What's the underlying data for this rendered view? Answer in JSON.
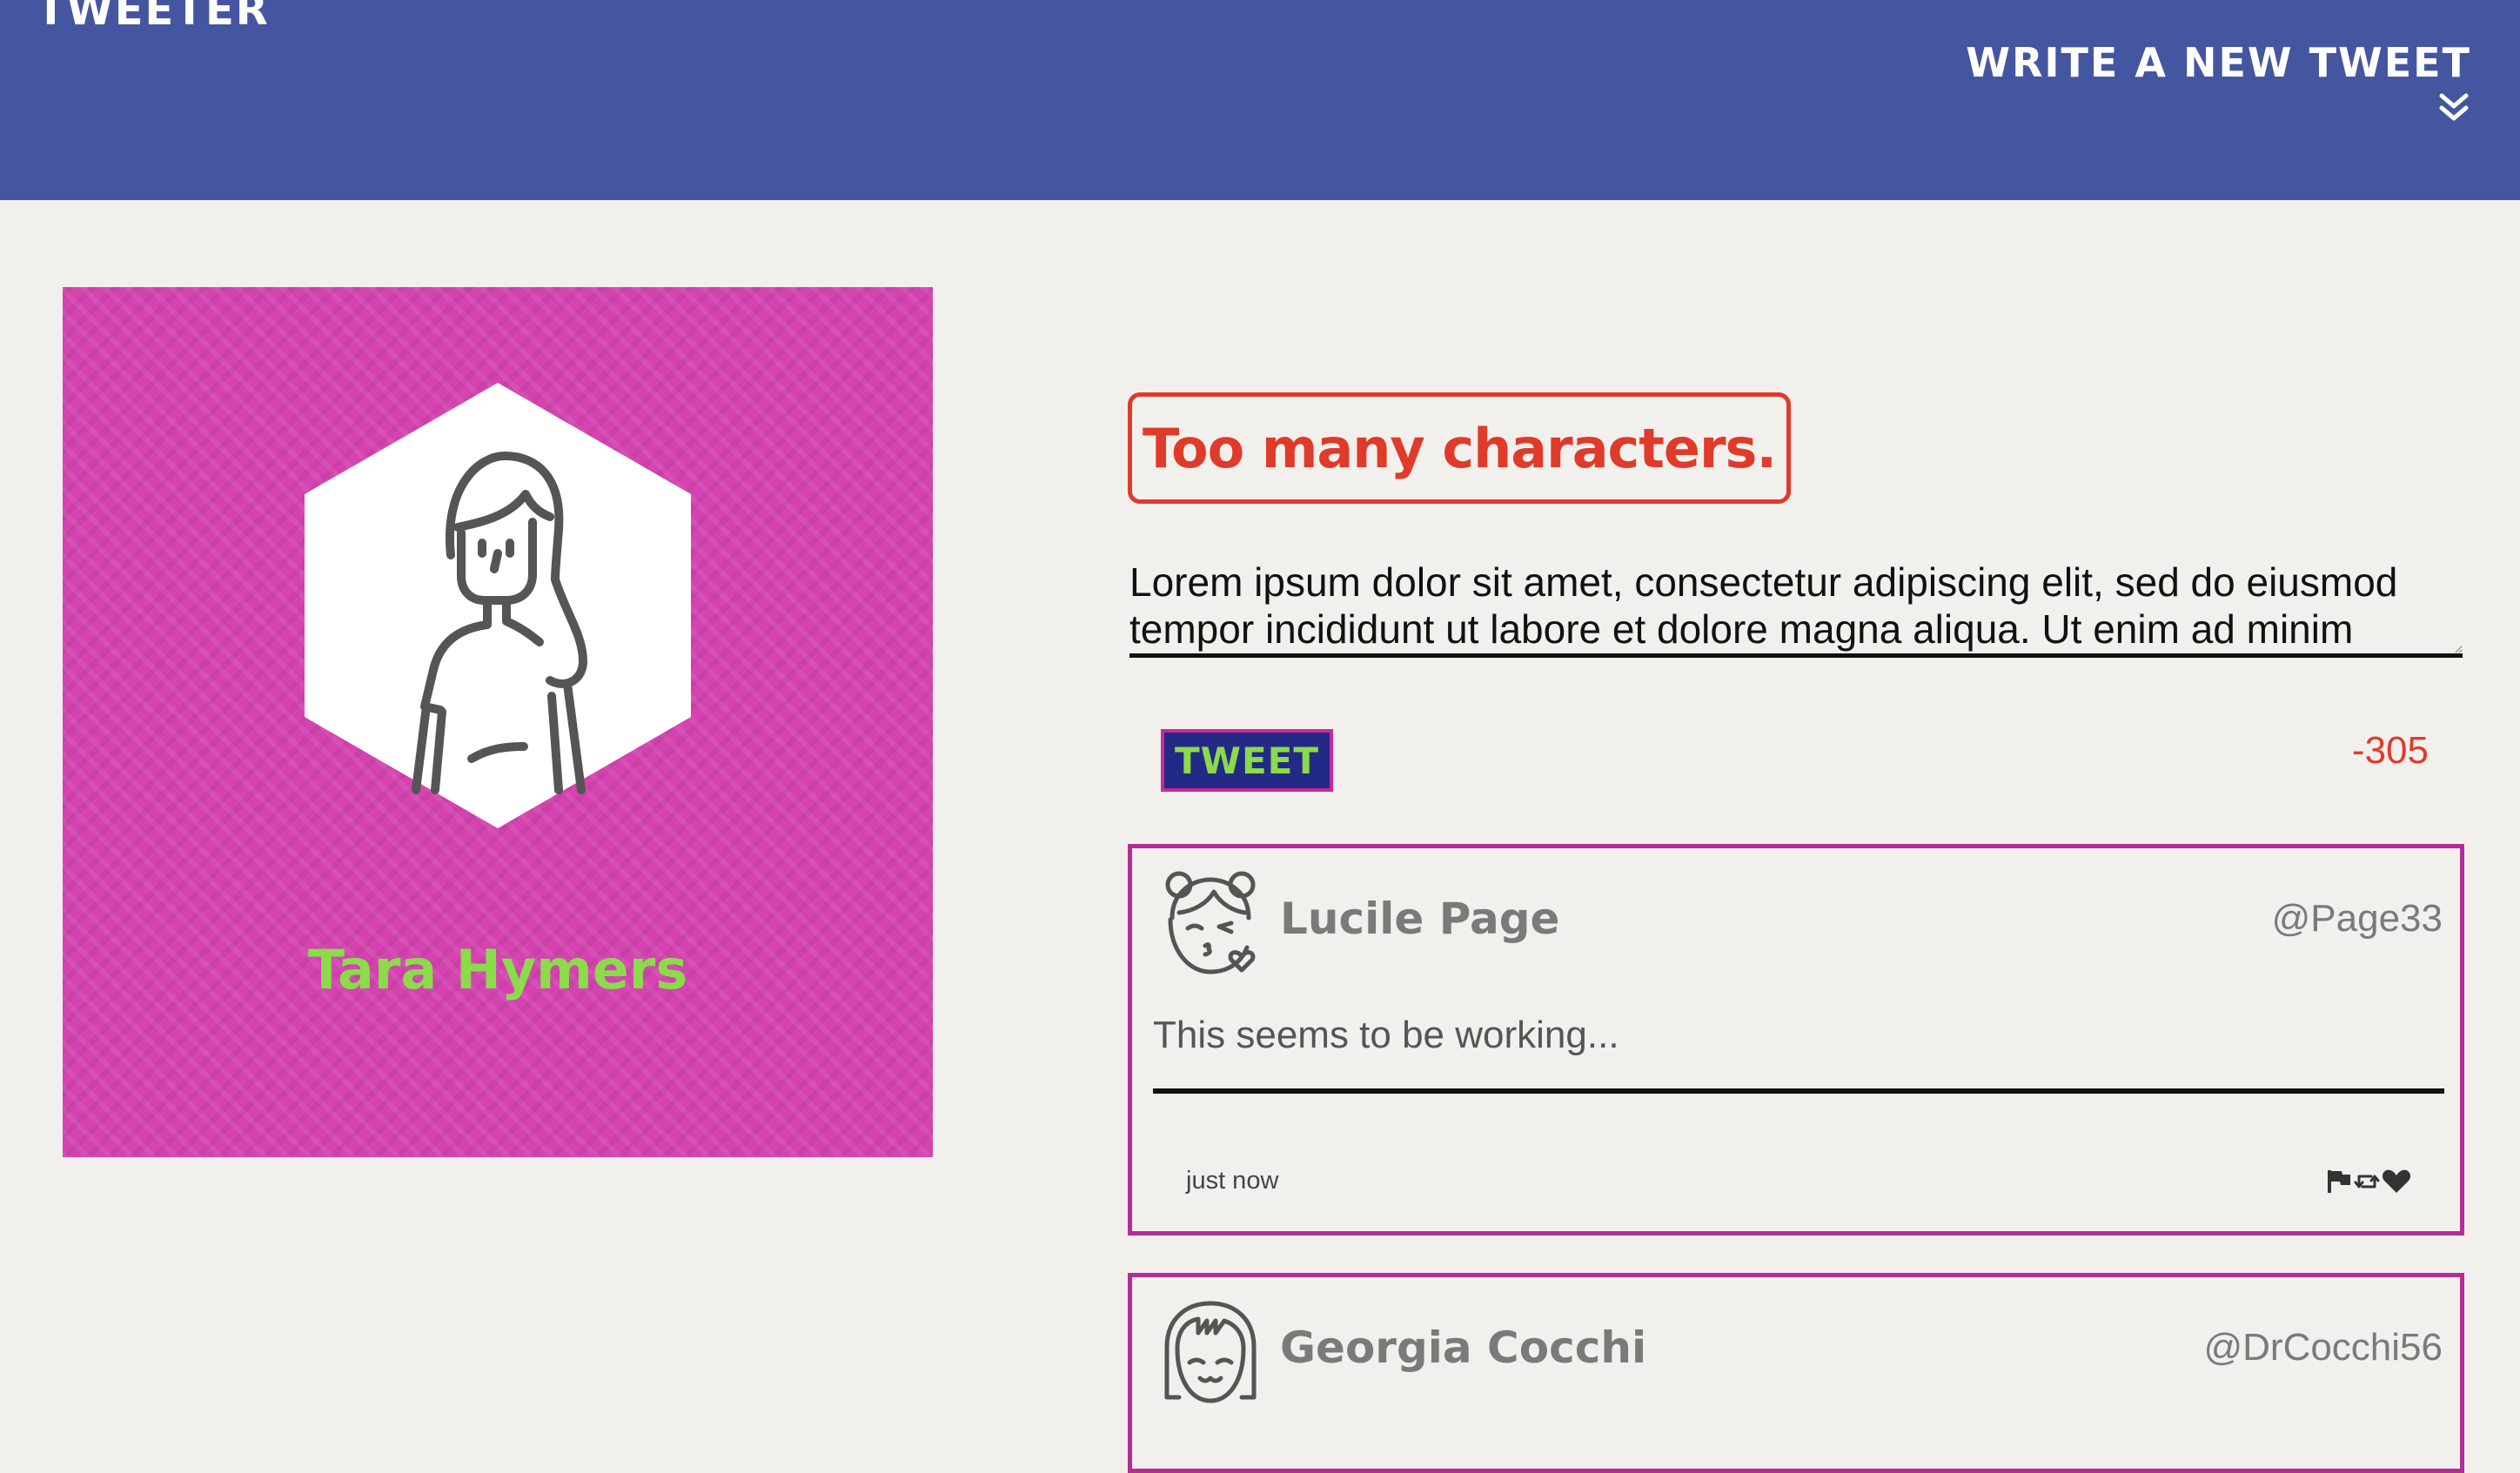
{
  "header": {
    "brand": "TWEETER",
    "compose_label": "WRITE A NEW TWEET",
    "compose_icon": "chevron-double-down-icon"
  },
  "profile": {
    "name": "Tara Hymers",
    "avatar_icon": "woman-avatar-icon",
    "colors": {
      "card": "#d443b0",
      "name": "#8bdb4a"
    }
  },
  "composer": {
    "error": "Too many characters.",
    "text": "Lorem ipsum dolor sit amet, consectetur adipiscing elit, sed do eiusmod tempor incididunt ut labore et dolore magna aliqua. Ut enim ad minim",
    "button_label": "TWEET",
    "counter": "-305",
    "colors": {
      "error": "#e03a2a",
      "button_bg": "#232a85",
      "button_text": "#8bdb4a"
    }
  },
  "tweets": [
    {
      "name": "Lucile Page",
      "handle": "@Page33",
      "text": "This seems to be working...",
      "time": "just now",
      "avatar_icon": "kissing-face-avatar-icon",
      "actions": [
        "flag-icon",
        "retweet-icon",
        "heart-icon"
      ]
    },
    {
      "name": "Georgia Cocchi",
      "handle": "@DrCocchi56",
      "avatar_icon": "smiling-face-avatar-icon"
    }
  ],
  "colors": {
    "header": "#4556a0",
    "page": "#f2f0ec",
    "tweet_border": "#b42c97"
  }
}
